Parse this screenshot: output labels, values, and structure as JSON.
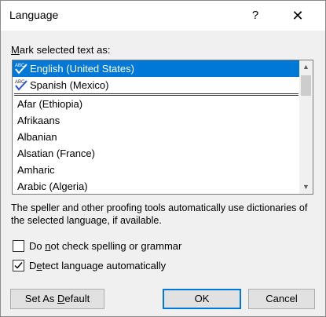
{
  "window": {
    "title": "Language",
    "help_glyph": "?",
    "close_glyph": "✕"
  },
  "mark_label": {
    "accel": "M",
    "rest": "ark selected text as:"
  },
  "language_list": {
    "pinned": [
      {
        "label": "English (United States)",
        "selected": true,
        "icon": "spell-check-icon"
      },
      {
        "label": "Spanish (Mexico)",
        "selected": false,
        "icon": "spell-check-icon"
      }
    ],
    "items": [
      "Afar (Ethiopia)",
      "Afrikaans",
      "Albanian",
      "Alsatian (France)",
      "Amharic",
      "Arabic (Algeria)"
    ]
  },
  "description": "The speller and other proofing tools automatically use dictionaries of the selected language, if available.",
  "checkboxes": {
    "no_check": {
      "pre": "Do ",
      "accel": "n",
      "post": "ot check spelling or grammar",
      "checked": false
    },
    "detect": {
      "pre": "D",
      "accel": "e",
      "post": "tect language automatically",
      "checked": true
    }
  },
  "buttons": {
    "set_default": {
      "pre": "Set As ",
      "accel": "D",
      "post": "efault"
    },
    "ok": "OK",
    "cancel": "Cancel"
  },
  "colors": {
    "selection": "#0078d7",
    "dialog_bg": "#f0f0f0"
  }
}
